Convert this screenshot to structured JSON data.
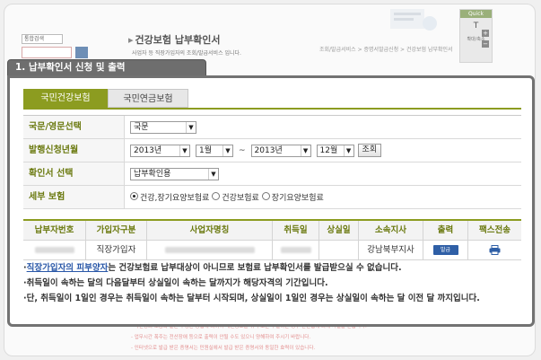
{
  "background": {
    "search_select": "통합검색",
    "page_title": "건강보험 납부확인서",
    "page_subtitle": "사업자 등 직장가입자의 조회/발급서비스 입니다.",
    "breadcrumb": "조회/발급서비스 > 증명서발급신청 > 건강보험 납부확인서",
    "quick": {
      "title": "Quick",
      "font_label": "T",
      "zoom_label": "확대/축소"
    },
    "footer_lines": [
      "- 타인명의 도용과 같은 부정한 방법에 의하여 개인정보를 취득 또는 누설하는 경우 관련법에 의해 처벌을 받습니다.",
      "- 업무시간 폭주는 전산장애 등으로 출력이 안될 수도 있으니 양해하여 주시기 바랍니다.",
      "- 인터넷으로 발급 받은 증명서는 민원실에서 발급 받은 증명서와 동일한 효력이 있습니다."
    ]
  },
  "step_title": "1. 납부확인서 신청 및 출력",
  "tabs": [
    {
      "label": "국민건강보험",
      "active": true
    },
    {
      "label": "국민연금보험",
      "active": false
    }
  ],
  "form": {
    "language": {
      "label": "국문/영문선택",
      "value": "국문"
    },
    "period": {
      "label": "발행신청년월",
      "from_year": "2013년",
      "from_month": "1월",
      "tilde": "~",
      "to_year": "2013년",
      "to_month": "12월",
      "search_button": "조회"
    },
    "purpose": {
      "label": "확인서 선택",
      "value": "납부확인용"
    },
    "insurance": {
      "label": "세부 보험",
      "options": [
        {
          "label": "건강,장기요양보험료",
          "selected": true
        },
        {
          "label": "건강보험료",
          "selected": false
        },
        {
          "label": "장기요양보험료",
          "selected": false
        }
      ]
    }
  },
  "table": {
    "headers": [
      "납부자번호",
      "가입자구분",
      "사업자명칭",
      "취득일",
      "상실일",
      "소속지사",
      "출력",
      "팩스전송"
    ],
    "row": {
      "subscriber_type": "직장가입자",
      "branch": "강남북부지사",
      "print_button": "발급"
    }
  },
  "notes": {
    "note1_link": "직장가입자의 피부양자",
    "note1_rest": "는 건강보험료 납부대상이 아니므로 보험료 납부확인서를 발급받으실 수 없습니다.",
    "note2": "취득일이 속하는 달의 다음달부터 상실일이 속하는 달까지가 해당자격의 기간입니다.",
    "note3": "단, 취득일이 1일인 경우는 취득일이 속하는 달부터 시작되며, 상실일이 1일인 경우는 상실일이 속하는 달 이전 달 까지입니다."
  }
}
